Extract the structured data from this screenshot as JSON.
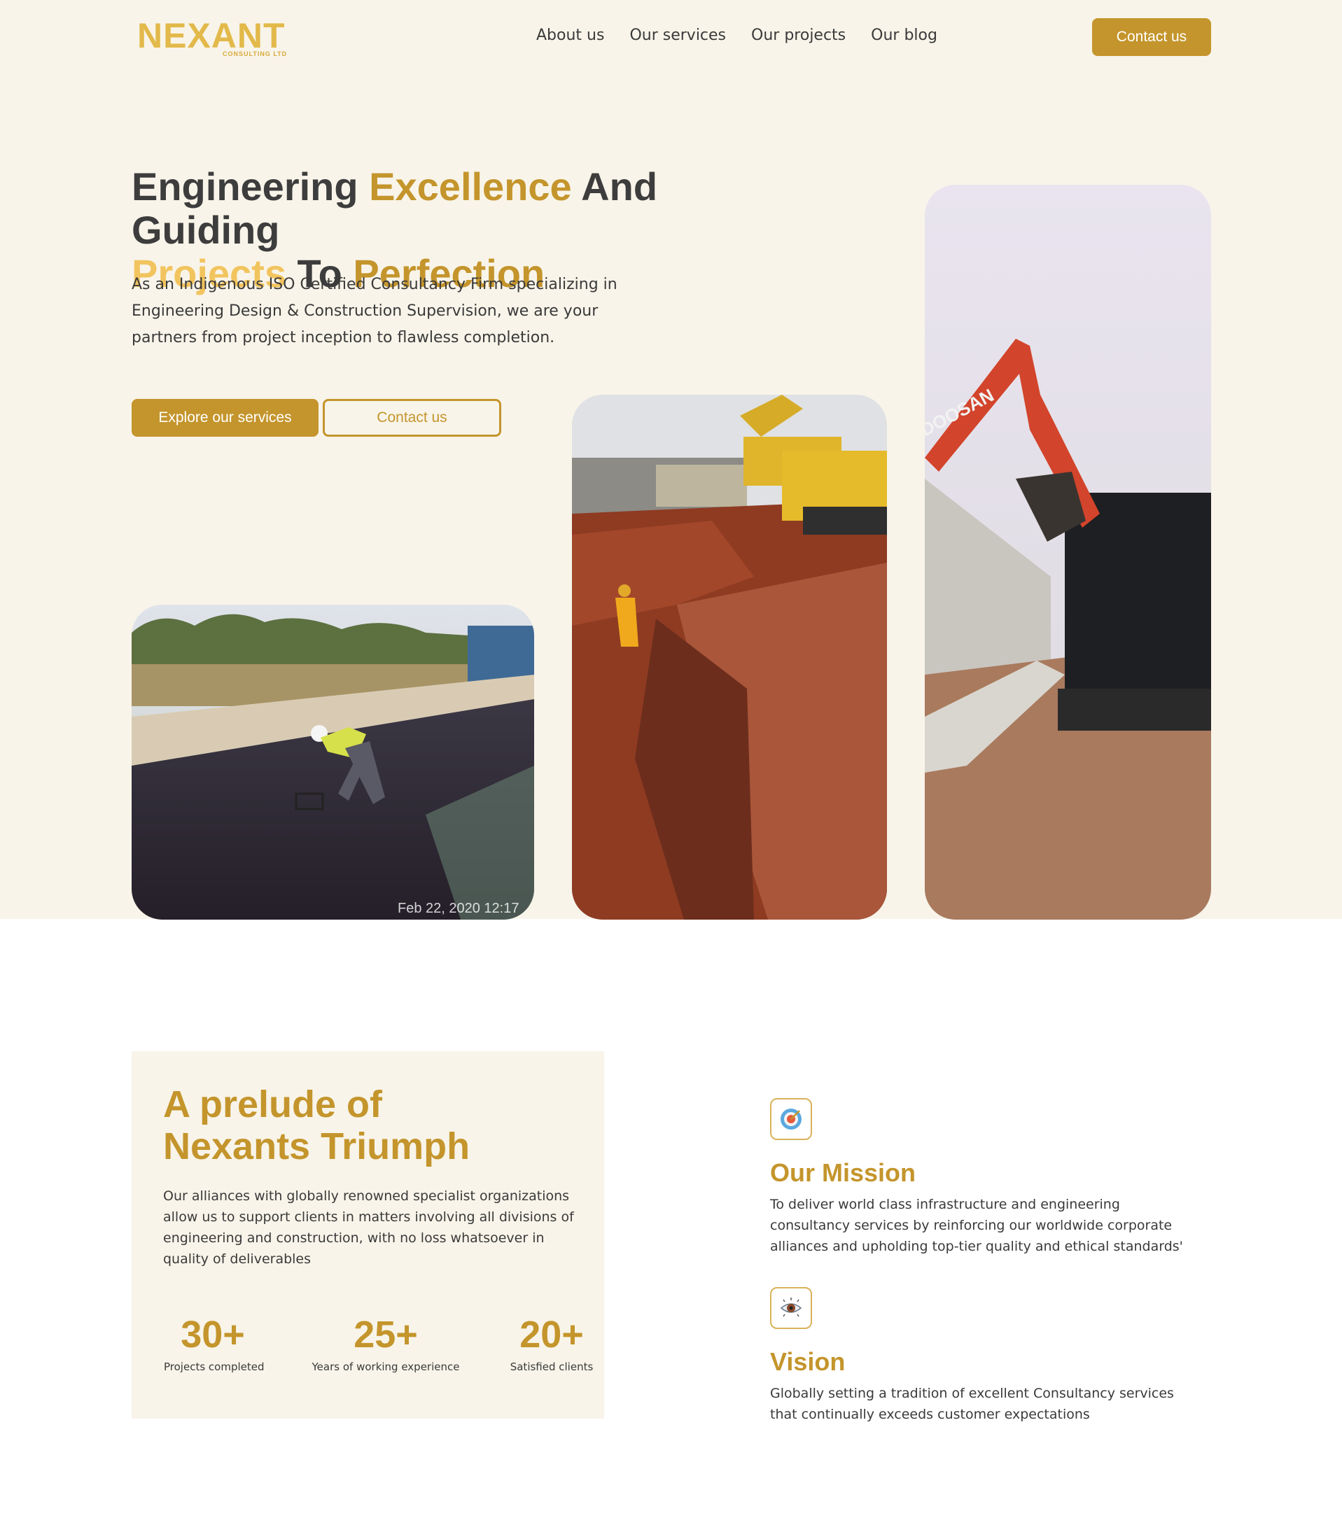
{
  "header": {
    "logo_text": "NEXANT",
    "logo_sub": "CONSULTING LTD",
    "nav": [
      "About us",
      "Our services",
      "Our projects",
      "Our blog"
    ],
    "contact_label": "Contact us"
  },
  "hero": {
    "title_parts": [
      "Engineering ",
      "Excellence",
      " And Guiding ",
      "Projects",
      " To ",
      "Perfection"
    ],
    "description": "As an Indigenous ISO Certified Consultancy Firm specializing in Engineering Design & Construction Supervision, we are your partners from project inception to flawless completion.",
    "primary_button": "Explore our services",
    "secondary_button": "Contact us",
    "photo_timestamp": "Feb 22, 2020 12:17"
  },
  "prelude": {
    "title_line1": "A prelude of",
    "title_line2": "Nexants Triumph",
    "text": "Our alliances with globally renowned specialist organizations allow us to support clients in matters involving all divisions of engineering and construction, with no loss whatsoever in quality of deliverables",
    "stats": [
      {
        "value": "30+",
        "label": "Projects completed"
      },
      {
        "value": "25+",
        "label": "Years of working experience"
      },
      {
        "value": "20+",
        "label": "Satisfied clients"
      }
    ]
  },
  "mission": {
    "title": "Our Mission",
    "text": "To deliver world class infrastructure and engineering consultancy services by reinforcing our worldwide corporate alliances and upholding top-tier quality and ethical standards'"
  },
  "vision": {
    "title": "Vision",
    "text": "Globally setting a tradition of excellent Consultancy services that continually exceeds customer expectations"
  },
  "colors": {
    "accent": "#c4952c",
    "hero_background": "#f8f4e9"
  },
  "icons": [
    "target-icon",
    "eye-icon"
  ]
}
